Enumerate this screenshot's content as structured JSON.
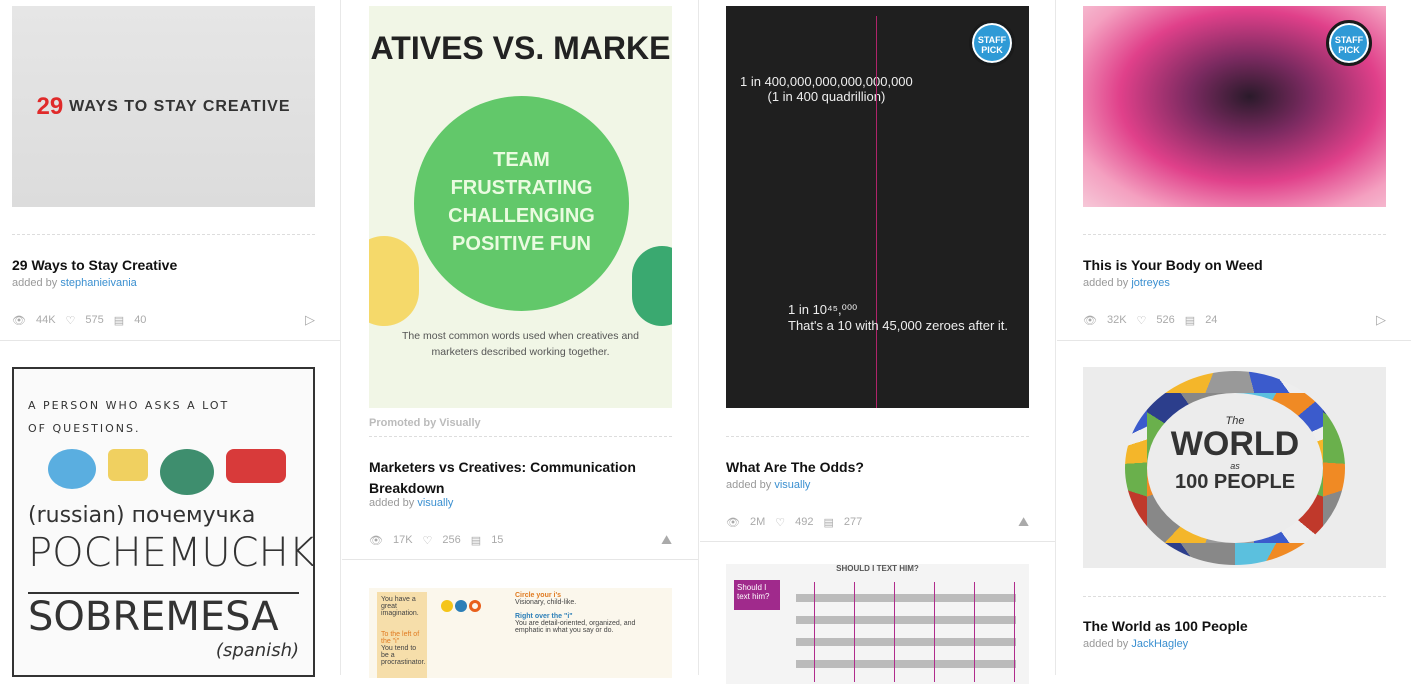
{
  "cards": [
    {
      "title": "29 Ways to Stay Creative",
      "added_by": "added by",
      "user": "stephanieivania",
      "views": "44K",
      "likes": "575",
      "comments": "40",
      "type_icon": "play-icon",
      "thumb_num": "29",
      "thumb_text": "WAYS TO STAY CREATIVE"
    },
    {
      "title": "Marketers vs Creatives: Communication Breakdown",
      "added_by": "added by",
      "user": "visually",
      "views": "17K",
      "likes": "256",
      "comments": "15",
      "type_icon": "infographic-icon",
      "promoted": "Promoted by Visually",
      "thumb_head": "ATIVES VS. MARKE",
      "thumb_words": "TEAM FRUSTRATING CHALLENGING POSITIVE FUN",
      "thumb_caption": "The most common words used when creatives and marketers described working together."
    },
    {
      "title": "What Are The Odds?",
      "added_by": "added by",
      "user": "visually",
      "views": "2M",
      "likes": "492",
      "comments": "277",
      "type_icon": "infographic-icon",
      "staff": "STAFF PICK",
      "thumb_line1": "1 in 400,000,000,000,000,000",
      "thumb_line2": "(1 in 400 quadrillion)",
      "thumb_line3": "1 in 10⁴⁵,⁰⁰⁰",
      "thumb_line4": "That's a 10 with 45,000 zeroes after it."
    },
    {
      "title": "This is Your Body on Weed",
      "added_by": "added by",
      "user": "jotreyes",
      "views": "32K",
      "likes": "526",
      "comments": "24",
      "type_icon": "play-icon",
      "staff": "STAFF PICK"
    },
    {
      "title": "The World as 100 People",
      "added_by": "added by",
      "user": "JackHagley",
      "thumb_t1": "The",
      "thumb_t2": "WORLD",
      "thumb_t3": "as",
      "thumb_t4": "100 PEOPLE"
    },
    {
      "thumb_lines": [
        "A PERSON WHO ASKS A LOT",
        "OF QUESTIONS.",
        "(russian) почемучка",
        "POCHEMUCHKA",
        "SOBREMESA",
        "(spanish)"
      ]
    },
    {
      "thumb_lines": [
        "You have a great imagination.",
        "Circle your i's",
        "Visionary, child-like.",
        "Right over the \"i\"",
        "You are detail-oriented, organized, and emphatic in what you say or do.",
        "To the left of the \"i\"",
        "You tend to be a procrastinator."
      ]
    },
    {
      "thumb_lines": [
        "SHOULD I TEXT HIM?",
        "Should I text him?"
      ]
    }
  ]
}
